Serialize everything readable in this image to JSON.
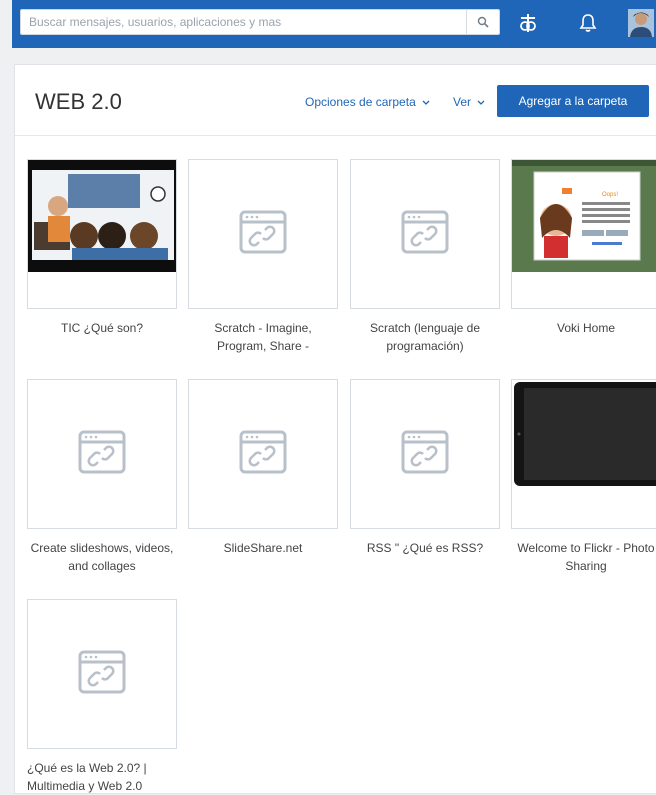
{
  "search": {
    "placeholder": "Buscar mensajes, usuarios, aplicaciones y mas"
  },
  "header": {
    "title": "WEB 2.0",
    "folder_options": "Opciones de carpeta",
    "view": "Ver",
    "add_button": "Agregar a la carpeta"
  },
  "colors": {
    "brand": "#1f66b9",
    "card_border": "#d7dce2",
    "background": "#eef0f2"
  },
  "items": [
    {
      "title": "TIC ¿Qué son?",
      "thumb": "video-image"
    },
    {
      "title": "Scratch - Imagine, Program, Share -",
      "thumb": "link-icon"
    },
    {
      "title": "Scratch (lenguaje de programación)",
      "thumb": "link-icon"
    },
    {
      "title": "Voki Home",
      "thumb": "screenshot-image",
      "popup_title": "Oops!"
    },
    {
      "title": "Create slideshows, videos, and collages",
      "thumb": "link-icon"
    },
    {
      "title": "SlideShare.net",
      "thumb": "link-icon"
    },
    {
      "title": "RSS \" ¿Qué es RSS?",
      "thumb": "link-icon"
    },
    {
      "title": "Welcome to Flickr - Photo Sharing",
      "thumb": "tablet-image"
    },
    {
      "title": "¿Qué es la Web 2.0? | Multimedia y Web 2.0",
      "thumb": "link-icon"
    }
  ]
}
